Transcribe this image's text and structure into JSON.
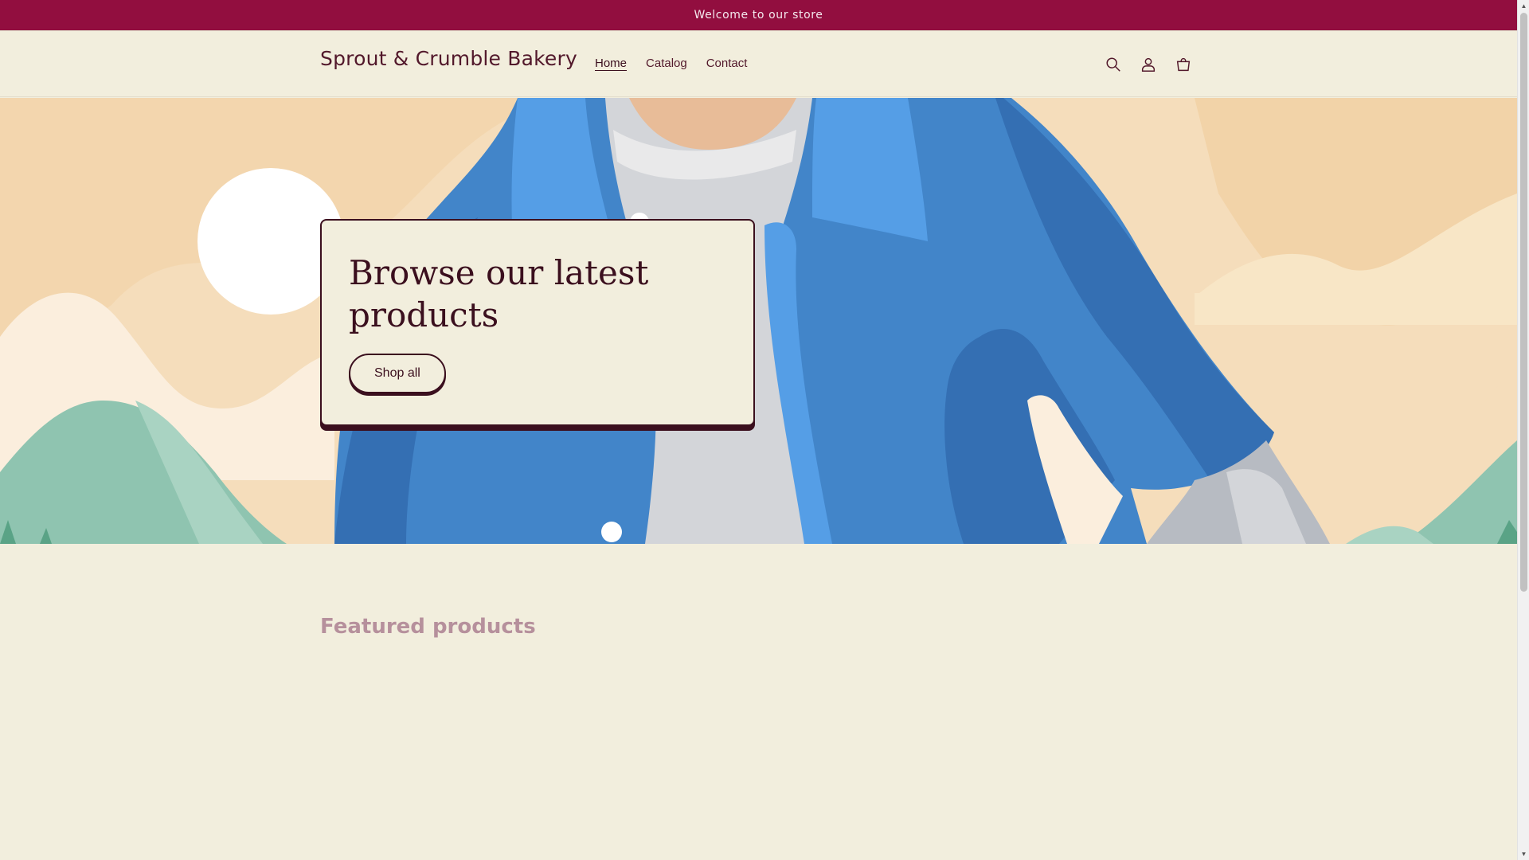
{
  "announcement": {
    "text": "Welcome to our store"
  },
  "header": {
    "brand": "Sprout & Crumble Bakery",
    "nav": [
      {
        "label": "Home",
        "active": true
      },
      {
        "label": "Catalog",
        "active": false
      },
      {
        "label": "Contact",
        "active": false
      }
    ],
    "icons": [
      "search-icon",
      "account-icon",
      "cart-icon"
    ]
  },
  "hero": {
    "title": "Browse our latest products",
    "button_label": "Shop all"
  },
  "featured": {
    "title": "Featured products"
  },
  "colors": {
    "announcement_bg": "#920e3f",
    "page_bg": "#f2eedd",
    "text": "#3b0f1e",
    "jacket_blue": "#4285c9"
  }
}
